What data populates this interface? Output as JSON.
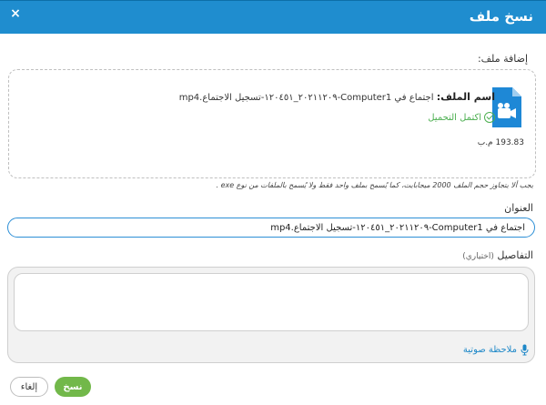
{
  "dialog": {
    "title": "نسخ ملف",
    "close_label": "×"
  },
  "upload": {
    "section_label": "إضافة ملف:",
    "file_name_label": "اسم الملف:",
    "file_name": "اجتماع في Computer1-٢٠٢١١٢٠٩_١٢٠٤٥١-تسجيل الاجتماع.mp4",
    "status": "اكتمل التحميل",
    "file_size": "193.83 م.ب",
    "file_icon": "video-file-icon"
  },
  "note": "يجب ألا يتجاوز حجم الملف 2000 ميجابايت، كما يُسمح بملف واحد فقط ولا يُسمح بالملفات من نوع exe .",
  "title_field": {
    "label": "العنوان",
    "value": "اجتماع في Computer1-٢٠٢١١٢٠٩_١٢٠٤٥١-تسجيل الاجتماع.mp4"
  },
  "details_field": {
    "label": "التفاصيل",
    "optional": "(اختياري)",
    "value": "",
    "voice_note_label": "ملاحظة صوتية",
    "voice_icon": "microphone-icon"
  },
  "buttons": {
    "copy": "نسخ",
    "cancel": "إلغاء"
  },
  "colors": {
    "header": "#1f8dcf",
    "success": "#4caf50",
    "primary_button": "#72b84a",
    "link": "#1e88c8",
    "input_border": "#2d8fd6"
  }
}
